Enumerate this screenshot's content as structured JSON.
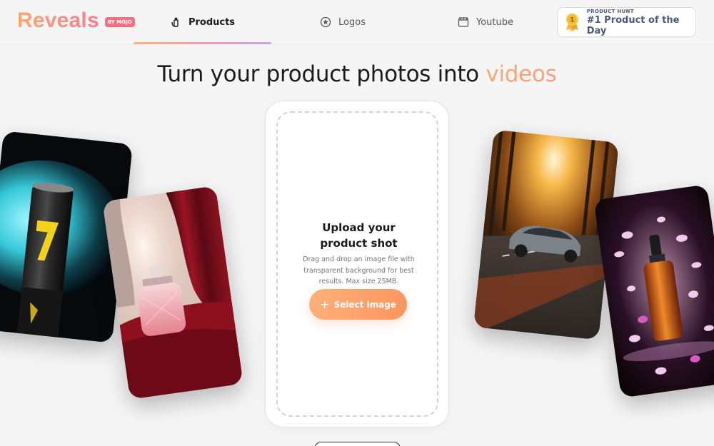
{
  "brand": {
    "name": "Reveals",
    "badge": "BY MOJO"
  },
  "nav": {
    "tabs": [
      {
        "label": "Products",
        "icon": "bottle-hand-icon",
        "active": true
      },
      {
        "label": "Logos",
        "icon": "star-circle-icon",
        "active": false
      },
      {
        "label": "Youtube",
        "icon": "clapperboard-icon",
        "active": false
      }
    ]
  },
  "product_hunt": {
    "top_label": "PRODUCT HUNT",
    "title": "#1 Product of the Day",
    "icon": "medal-icon"
  },
  "headline": {
    "main": "Turn your product photos into ",
    "accent": "videos"
  },
  "upload": {
    "title": "Upload your product shot",
    "description": "Drag and drop an image file with transparent background for best results. Max size 25MB.",
    "button_label": "Select image",
    "button_icon": "plus-icon"
  },
  "samples": [
    {
      "subject": "energy-drink-can"
    },
    {
      "subject": "perfume-bottle"
    },
    {
      "subject": "car-forest-road"
    },
    {
      "subject": "serum-bottle-flowers"
    }
  ],
  "colors": {
    "accent_start": "#ffa66e",
    "accent_end": "#f67d8e",
    "button": "#fb9560"
  }
}
